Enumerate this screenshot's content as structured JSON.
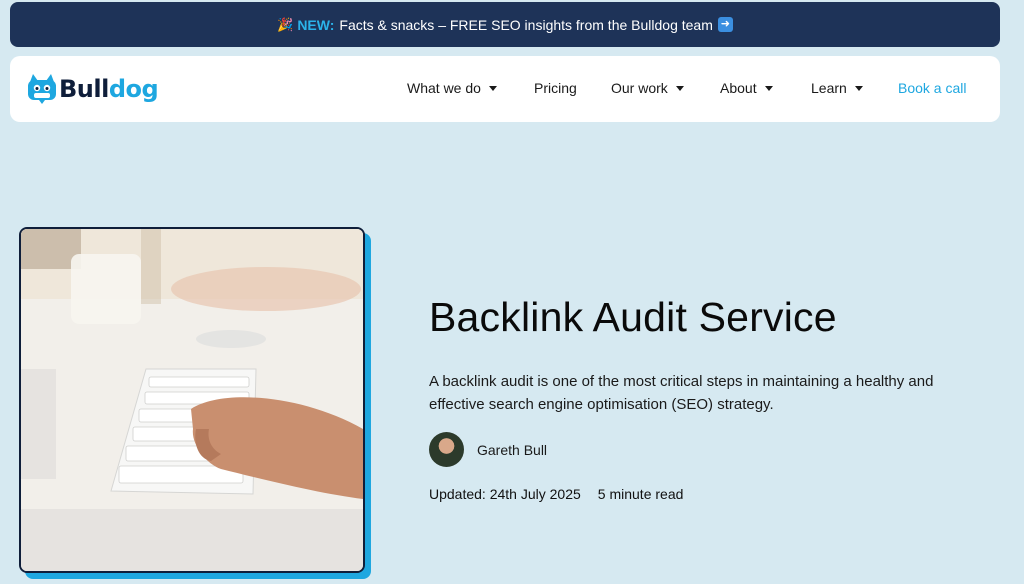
{
  "announcement": {
    "icon": "party-popper-icon",
    "new_label": "NEW:",
    "text": "Facts & snacks – FREE SEO insights from the Bulldog team",
    "arrow_icon": "right-arrow-icon"
  },
  "nav": {
    "logo_text_part1": "Bull",
    "logo_text_part2": "dog",
    "items": [
      {
        "label": "What we do",
        "dropdown": true
      },
      {
        "label": "Pricing",
        "dropdown": false
      },
      {
        "label": "Our work",
        "dropdown": true
      },
      {
        "label": "About",
        "dropdown": true
      },
      {
        "label": "Learn",
        "dropdown": true
      }
    ],
    "cta": "Book a call"
  },
  "article": {
    "title": "Backlink Audit Service",
    "description": "A backlink audit is one of the most critical steps in maintaining a healthy and effective search engine optimisation (SEO) strategy.",
    "author": "Gareth Bull",
    "updated": "Updated: 24th July 2025",
    "read_time": "5 minute read"
  },
  "colors": {
    "background": "#d6e9f1",
    "announcement_bg": "#1e3358",
    "accent": "#1ea7e0",
    "dark": "#0f1e3a"
  }
}
